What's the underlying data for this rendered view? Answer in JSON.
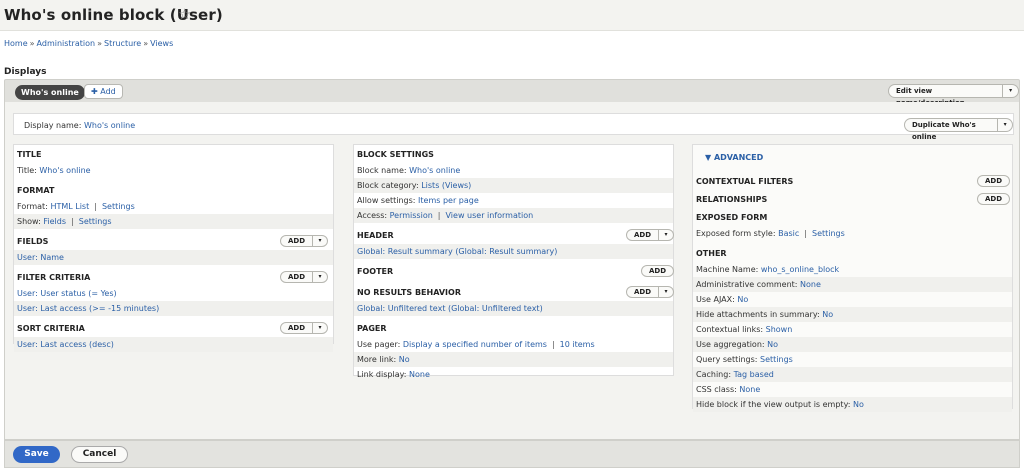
{
  "header": {
    "title": "Who's online block (User)",
    "star_icon": "☆"
  },
  "breadcrumb": [
    "Home",
    "Administration",
    "Structure",
    "Views"
  ],
  "breadcrumb_sep": "»",
  "displays_title": "Displays",
  "tabs": {
    "active": "Who's online",
    "add": "Add",
    "add_icon": "✚",
    "edit_view": "Edit view name/description",
    "dropdown_icon": "▾"
  },
  "display_name": {
    "label": "Display name:",
    "value": "Who's online",
    "duplicate": "Duplicate Who's online"
  },
  "left": {
    "title_cat": "TITLE",
    "title_label": "Title:",
    "title_value": "Who's online",
    "format_cat": "FORMAT",
    "format_label": "Format:",
    "format_value": "HTML List",
    "format_settings": "Settings",
    "show_label": "Show:",
    "show_value": "Fields",
    "show_settings": "Settings",
    "fields_cat": "FIELDS",
    "fields_add": "Add",
    "fields": [
      "User: Name"
    ],
    "filter_cat": "FILTER CRITERIA",
    "filter_add": "Add",
    "filters": [
      "User: User status (= Yes)",
      "User: Last access (>= -15 minutes)"
    ],
    "sort_cat": "SORT CRITERIA",
    "sort_add": "Add",
    "sorts": [
      "User: Last access (desc)"
    ]
  },
  "middle": {
    "block_cat": "BLOCK SETTINGS",
    "block_name_label": "Block name:",
    "block_name_value": "Who's online",
    "block_category_label": "Block category:",
    "block_category_value": "Lists (Views)",
    "allow_label": "Allow settings:",
    "allow_value": "Items per page",
    "access_label": "Access:",
    "access_value": "Permission",
    "access_value2": "View user information",
    "header_cat": "HEADER",
    "header_add": "Add",
    "header_item": "Global: Result summary (Global: Result summary)",
    "footer_cat": "FOOTER",
    "footer_add": "Add",
    "noresults_cat": "NO RESULTS BEHAVIOR",
    "noresults_add": "Add",
    "noresults_item": "Global: Unfiltered text (Global: Unfiltered text)",
    "pager_cat": "PAGER",
    "use_pager_label": "Use pager:",
    "use_pager_value": "Display a specified number of items",
    "use_pager_value2": "10 items",
    "more_link_label": "More link:",
    "more_link_value": "No",
    "link_display_label": "Link display:",
    "link_display_value": "None"
  },
  "right": {
    "advanced": "▼ ADVANCED",
    "contextual_cat": "CONTEXTUAL FILTERS",
    "contextual_add": "Add",
    "relationships_cat": "RELATIONSHIPS",
    "relationships_add": "Add",
    "exposed_cat": "EXPOSED FORM",
    "exposed_label": "Exposed form style:",
    "exposed_value": "Basic",
    "exposed_settings": "Settings",
    "other_cat": "OTHER",
    "other_rows": [
      {
        "label": "Machine Name:",
        "value": "who_s_online_block"
      },
      {
        "label": "Administrative comment:",
        "value": "None"
      },
      {
        "label": "Use AJAX:",
        "value": "No"
      },
      {
        "label": "Hide attachments in summary:",
        "value": "No"
      },
      {
        "label": "Contextual links:",
        "value": "Shown"
      },
      {
        "label": "Use aggregation:",
        "value": "No"
      },
      {
        "label": "Query settings:",
        "value": "Settings"
      },
      {
        "label": "Caching:",
        "value": "Tag based"
      },
      {
        "label": "CSS class:",
        "value": "None"
      },
      {
        "label": "Hide block if the view output is empty:",
        "value": "No"
      }
    ]
  },
  "footer": {
    "save": "Save",
    "cancel": "Cancel"
  }
}
